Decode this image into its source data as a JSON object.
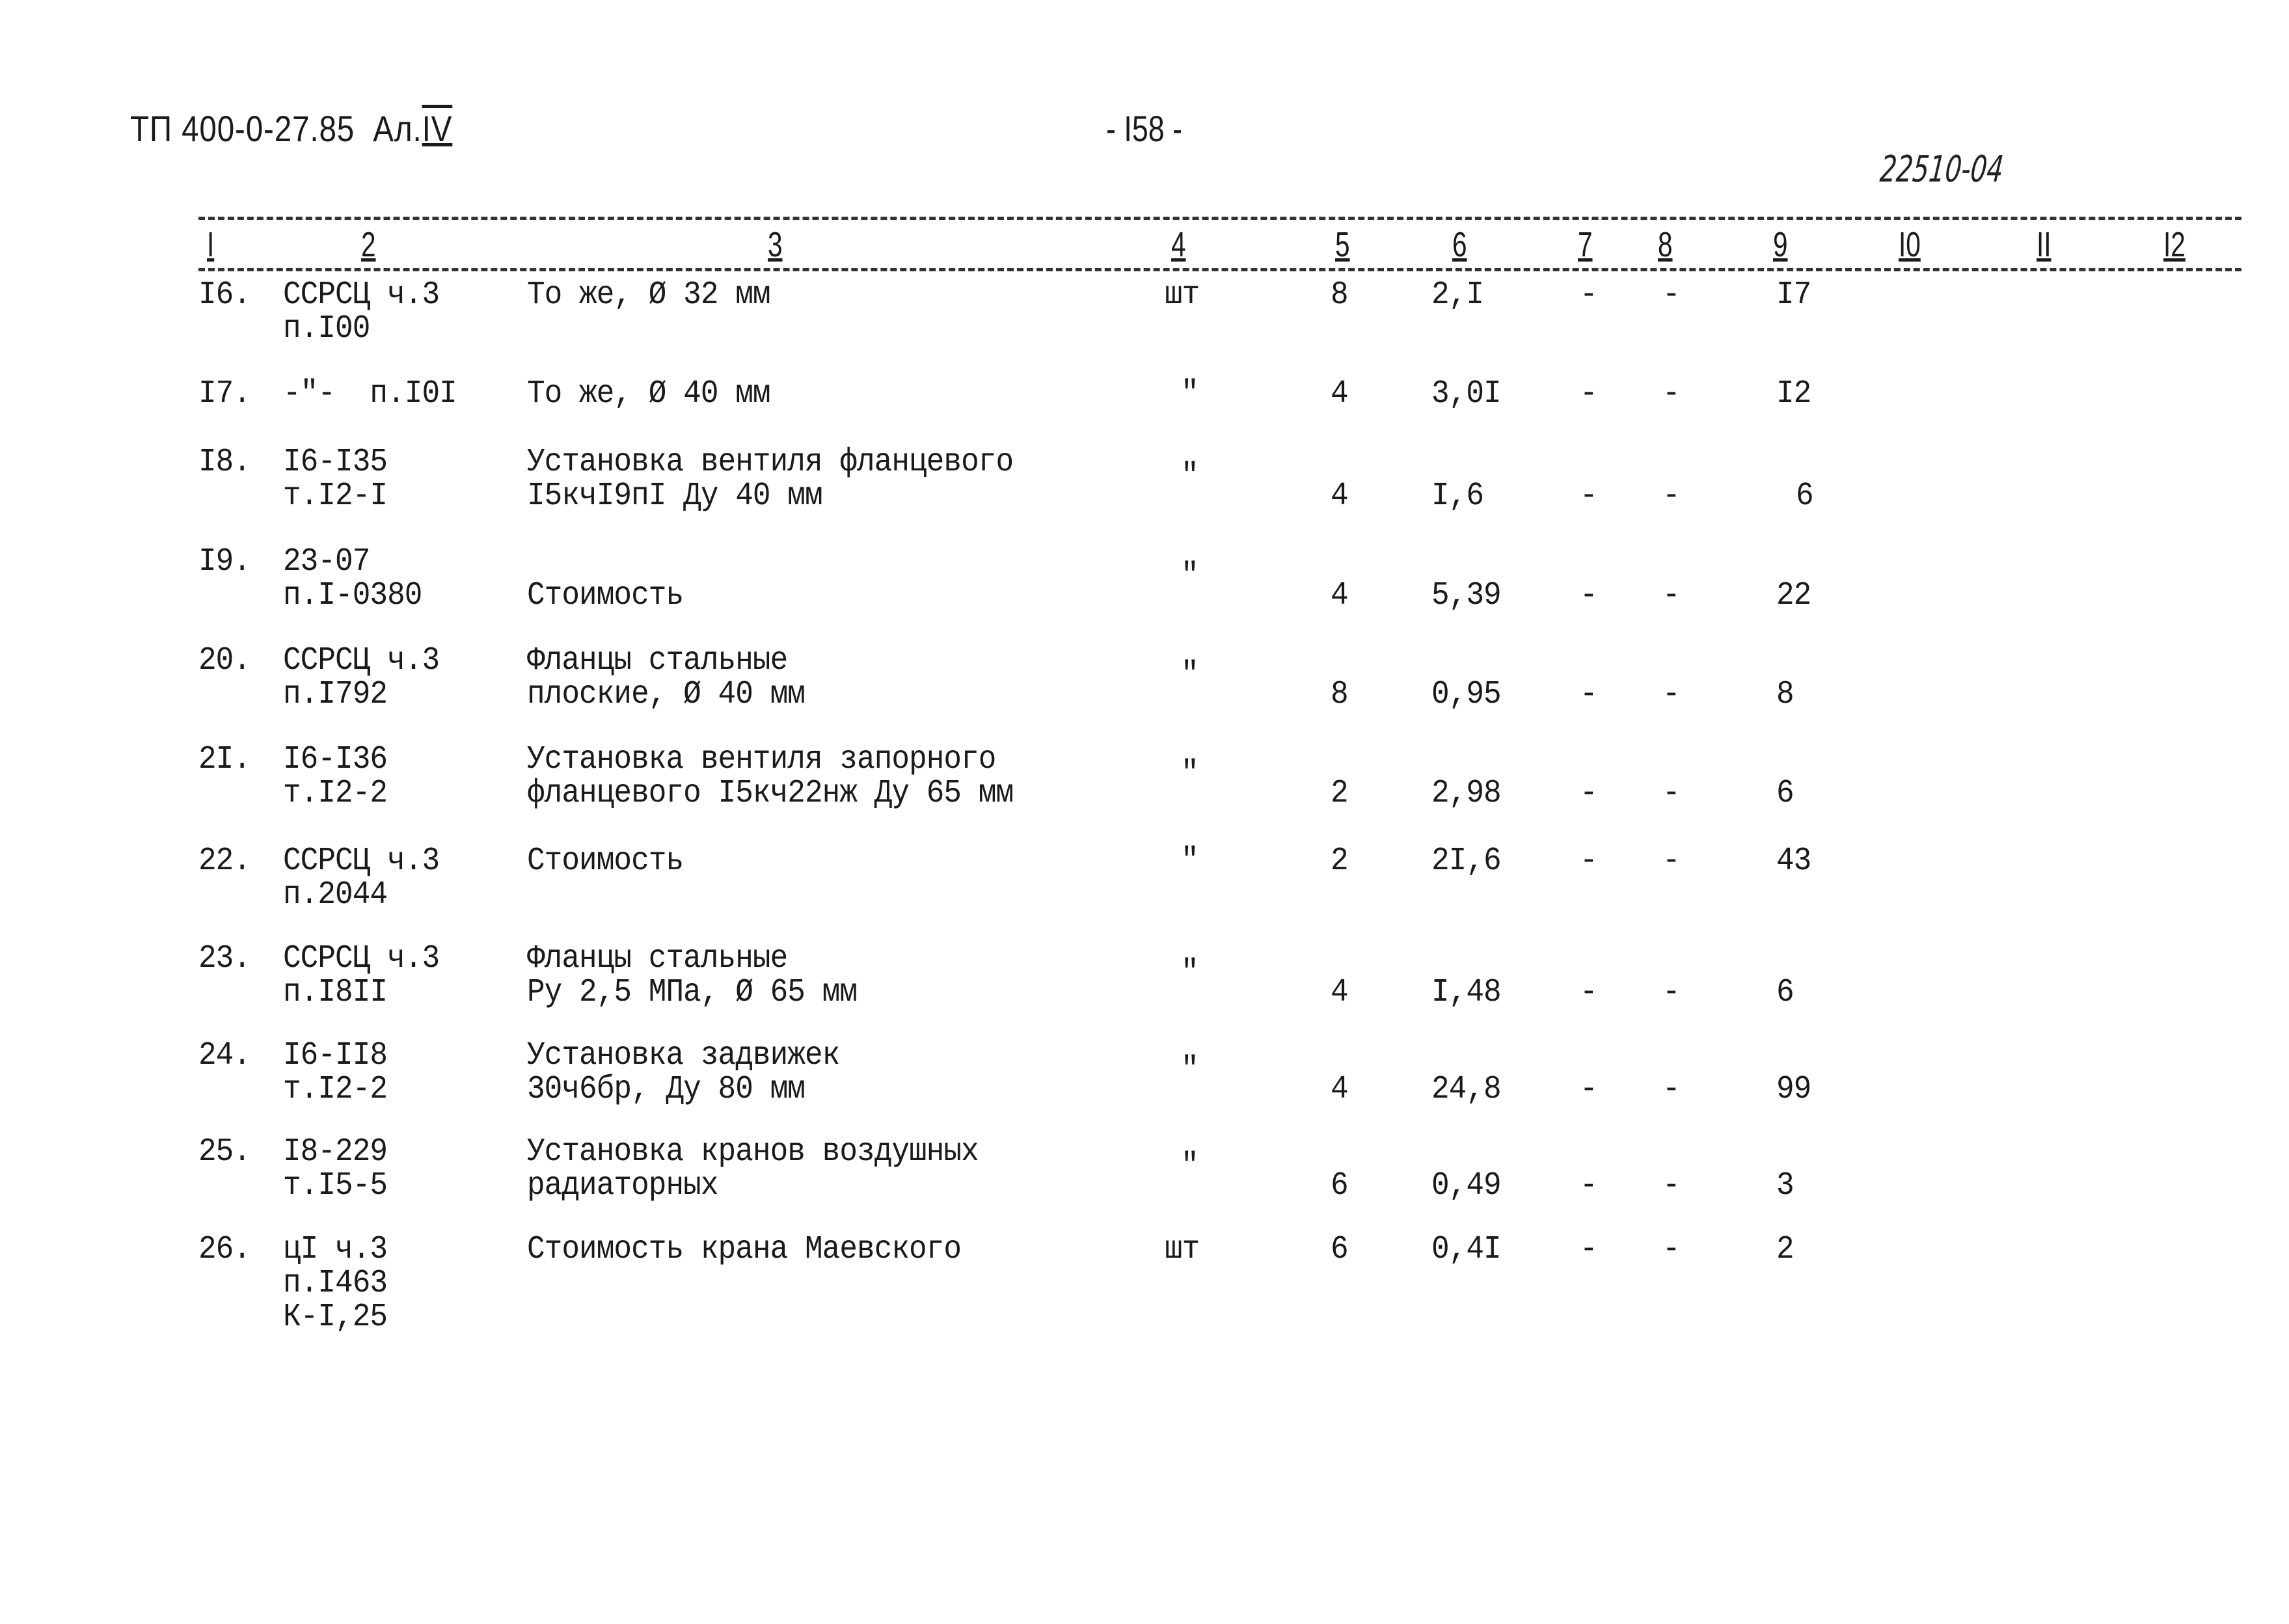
{
  "header": {
    "doc_code": "ТП 400-0-27.85",
    "album_label": "Ал.",
    "album_number": "IV",
    "page_number": "- I58 -",
    "stamp": "22510-04"
  },
  "table": {
    "columns": [
      "I",
      "2",
      "3",
      "4",
      "5",
      "6",
      "7",
      "8",
      "9",
      "I0",
      "II",
      "I2"
    ],
    "rows": [
      {
        "num": "I6.",
        "code": [
          "ССРСЦ ч.3",
          "п.I00"
        ],
        "desc": [
          "То же, Ø 32 мм"
        ],
        "unit": "шт",
        "qty": "8",
        "price": "2,I",
        "c7": "-",
        "c8": "-",
        "c9": "I7",
        "desc_offset": 0
      },
      {
        "num": "I7.",
        "code": [
          "-\"-  п.I0I"
        ],
        "desc": [
          "То же, Ø 40 мм"
        ],
        "unit": "\"",
        "qty": "4",
        "price": "3,0I",
        "c7": "-",
        "c8": "-",
        "c9": "I2",
        "desc_offset": 0
      },
      {
        "num": "I8.",
        "code": [
          "I6-I35",
          "т.I2-I"
        ],
        "desc": [
          "Установка вентиля фланцевого",
          "I5кчI9пI Ду 40 мм"
        ],
        "unit": "\"",
        "qty": "4",
        "price": "I,6",
        "c7": "-",
        "c8": "-",
        "c9": "6",
        "desc_offset": 0
      },
      {
        "num": "I9.",
        "code": [
          "23-07",
          "п.I-0380"
        ],
        "desc": [
          "",
          "Стоимость"
        ],
        "unit": "\"",
        "qty": "4",
        "price": "5,39",
        "c7": "-",
        "c8": "-",
        "c9": "22",
        "desc_offset": 0
      },
      {
        "num": "20.",
        "code": [
          "ССРСЦ ч.3",
          "п.I792"
        ],
        "desc": [
          "Фланцы стальные",
          "плоские, Ø 40 мм"
        ],
        "unit": "\"",
        "qty": "8",
        "price": "0,95",
        "c7": "-",
        "c8": "-",
        "c9": "8",
        "desc_offset": 0
      },
      {
        "num": "2I.",
        "code": [
          "I6-I36",
          "т.I2-2"
        ],
        "desc": [
          "Установка вентиля запорного",
          "фланцевого I5кч22нж Ду 65 мм"
        ],
        "unit": "\"",
        "qty": "2",
        "price": "2,98",
        "c7": "-",
        "c8": "-",
        "c9": "6",
        "desc_offset": 0
      },
      {
        "num": "22.",
        "code": [
          "ССРСЦ ч.3",
          "п.2044"
        ],
        "desc": [
          "Стоимость"
        ],
        "unit": "\"",
        "qty": "2",
        "price": "2I,6",
        "c7": "-",
        "c8": "-",
        "c9": "43",
        "desc_offset": 0
      },
      {
        "num": "23.",
        "code": [
          "ССРСЦ ч.3",
          "п.I8II"
        ],
        "desc": [
          "Фланцы стальные",
          "Ру 2,5 МПа, Ø 65 мм"
        ],
        "unit": "\"",
        "qty": "4",
        "price": "I,48",
        "c7": "-",
        "c8": "-",
        "c9": "6",
        "desc_offset": 0
      },
      {
        "num": "24.",
        "code": [
          "I6-II8",
          "т.I2-2"
        ],
        "desc": [
          "Установка задвижек",
          "30ч6бр, Ду 80 мм"
        ],
        "unit": "\"",
        "qty": "4",
        "price": "24,8",
        "c7": "-",
        "c8": "-",
        "c9": "99",
        "desc_offset": 0
      },
      {
        "num": "25.",
        "code": [
          "I8-229",
          "т.I5-5"
        ],
        "desc": [
          "Установка кранов воздушных",
          "радиаторных"
        ],
        "unit": "\"",
        "qty": "6",
        "price": "0,49",
        "c7": "-",
        "c8": "-",
        "c9": "3",
        "desc_offset": 0
      },
      {
        "num": "26.",
        "code": [
          "цI ч.3",
          "п.I463",
          "К-I,25"
        ],
        "desc": [
          "Стоимость крана Маевского"
        ],
        "unit": "шт",
        "qty": "6",
        "price": "0,4I",
        "c7": "-",
        "c8": "-",
        "c9": "2",
        "desc_offset": 0
      }
    ]
  }
}
